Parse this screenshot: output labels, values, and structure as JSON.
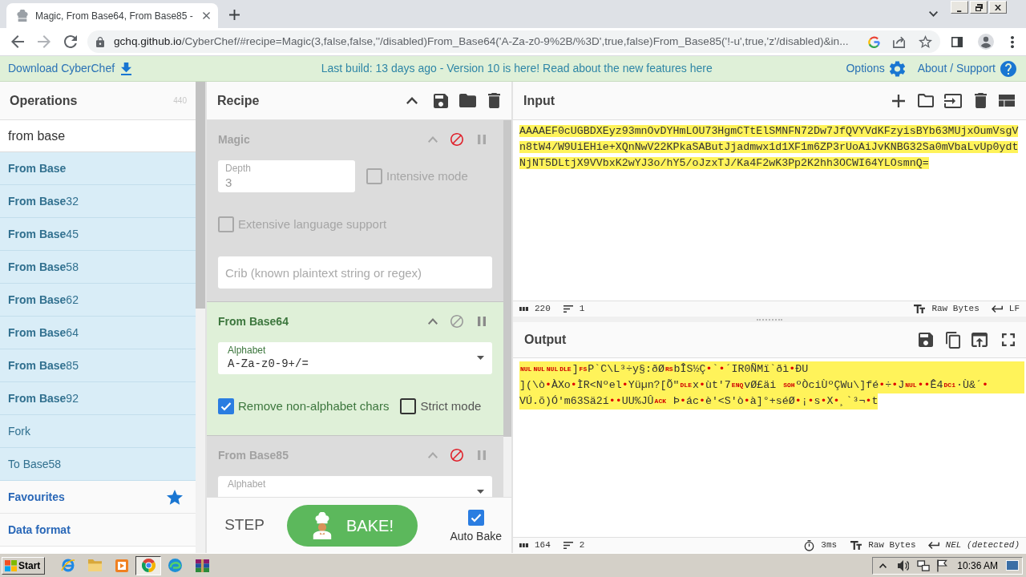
{
  "browser": {
    "tab_title": "Magic, From Base64, From Base85 -",
    "url": {
      "host": "gchq.github.io",
      "path": "/CyberChef/#recipe=Magic(3,false,false,''/disabled)From_Base64('A-Za-z0-9%2B/%3D',true,false)From_Base85('!-u',true,'z'/disabled)&in..."
    }
  },
  "banner": {
    "download": "Download CyberChef",
    "notice": "Last build: 13 days ago - Version 10 is here! Read about the new features here",
    "options": "Options",
    "about": "About / Support"
  },
  "operations": {
    "title": "Operations",
    "count": "440",
    "search": "from base",
    "items": [
      {
        "kind": "operation",
        "match": "From Base"
      },
      {
        "kind": "operation",
        "match": "From Base",
        "rest": "32"
      },
      {
        "kind": "operation",
        "match": "From Base",
        "rest": "45"
      },
      {
        "kind": "operation",
        "match": "From Base",
        "rest": "58"
      },
      {
        "kind": "operation",
        "match": "From Base",
        "rest": "62"
      },
      {
        "kind": "operation",
        "match": "From Base",
        "rest": "64"
      },
      {
        "kind": "operation",
        "match": "From Base",
        "rest": "85"
      },
      {
        "kind": "operation",
        "match": "From Base",
        "rest": "92"
      },
      {
        "kind": "operation",
        "rest": "Fork"
      },
      {
        "kind": "operation",
        "rest": "To Base58"
      },
      {
        "kind": "category",
        "rest": "Favourites",
        "star": true
      },
      {
        "kind": "category",
        "rest": "Data format"
      }
    ]
  },
  "recipe": {
    "title": "Recipe",
    "ops": [
      {
        "name": "Magic",
        "disabled": true,
        "args": [
          {
            "kind": "number",
            "label": "Depth",
            "value": "3"
          },
          {
            "kind": "checkbox",
            "label": "Intensive mode",
            "checked": false
          },
          {
            "kind": "checkbox",
            "label": "Extensive language support",
            "checked": false
          },
          {
            "kind": "text",
            "placeholder": "Crib (known plaintext string or regex)"
          }
        ]
      },
      {
        "name": "From Base64",
        "disabled": false,
        "args": [
          {
            "kind": "select",
            "label": "Alphabet",
            "value": "A-Za-z0-9+/="
          },
          {
            "kind": "checkbox",
            "label": "Remove non-alphabet chars",
            "checked": true
          },
          {
            "kind": "checkbox",
            "label": "Strict mode",
            "checked": false
          }
        ]
      },
      {
        "name": "From Base85",
        "disabled": true,
        "args": [
          {
            "kind": "select",
            "label": "Alphabet"
          }
        ]
      }
    ],
    "step": "STEP",
    "bake": "BAKE!",
    "auto_bake": {
      "label": "Auto Bake",
      "checked": true
    }
  },
  "input": {
    "title": "Input",
    "text": "AAAAEF0cUGBDXEyz93mnOvDYHmLOU73HgmCTtElSMNFN72Dw7JfQVYVdKFzyisBYb63MUjxOumVsgVn8tW4/W9UiEHie+XQnNwV22KPkaSAButJjadmwx1d1XF1m6ZP3rUoAiJvKNBG32Sa0mVbaLvUp0ydtNjNT5DLtjX9VVbxK2wYJ3o/hY5/oJzxTJ/Ka4F2wK3Pp2K2hh3OCWI64YLOsmnQ=",
    "highlighted": true,
    "status": {
      "length": "220",
      "lines": "1",
      "format": "Raw Bytes",
      "eol": "LF"
    }
  },
  "output": {
    "title": "Output",
    "highlighted": true,
    "lines": [
      {
        "segments": [
          {
            "kind": "control",
            "text": "NUL"
          },
          {
            "kind": "control",
            "text": "NUL"
          },
          {
            "kind": "control",
            "text": "NUL"
          },
          {
            "kind": "control",
            "text": "DLE"
          },
          {
            "kind": "text",
            "text": "]"
          },
          {
            "kind": "control",
            "text": "FS"
          },
          {
            "kind": "text",
            "text": "P`C\\L³÷y§:ðØ"
          },
          {
            "kind": "control",
            "text": "RS"
          },
          {
            "kind": "text",
            "text": "bÎS½Ç"
          },
          {
            "kind": "special",
            "text": "•"
          },
          {
            "kind": "text",
            "text": "`"
          },
          {
            "kind": "special",
            "text": "•"
          },
          {
            "kind": "text",
            "text": "´IR0ÑMï`ðì"
          },
          {
            "kind": "special",
            "text": "•"
          },
          {
            "kind": "text",
            "text": "ÐU"
          }
        ]
      },
      {
        "segments": [
          {
            "kind": "text",
            "text": "](\\ò"
          },
          {
            "kind": "special",
            "text": "•"
          },
          {
            "kind": "text",
            "text": "ÀXo"
          },
          {
            "kind": "special",
            "text": "•"
          },
          {
            "kind": "text",
            "text": "ÌR<Nºel"
          },
          {
            "kind": "special",
            "text": "•"
          },
          {
            "kind": "text",
            "text": "Yüµn?[Õ\""
          },
          {
            "kind": "control",
            "text": "DLE"
          },
          {
            "kind": "text",
            "text": "x"
          },
          {
            "kind": "special",
            "text": "•"
          },
          {
            "kind": "text",
            "text": "ùt'7"
          },
          {
            "kind": "control",
            "text": "ENQ"
          },
          {
            "kind": "text",
            "text": "vØ£äi "
          },
          {
            "kind": "control",
            "text": "SOH"
          },
          {
            "kind": "text",
            "text": "ºÒciÙºÇWu\\]fé"
          },
          {
            "kind": "special",
            "text": "•"
          },
          {
            "kind": "text",
            "text": "÷"
          },
          {
            "kind": "special",
            "text": "•"
          },
          {
            "kind": "text",
            "text": "J"
          },
          {
            "kind": "control",
            "text": "NUL"
          },
          {
            "kind": "special",
            "text": "••"
          },
          {
            "kind": "text",
            "text": "Ê4"
          },
          {
            "kind": "control",
            "text": "DC1"
          },
          {
            "kind": "text",
            "text": "·Ù&´"
          },
          {
            "kind": "special",
            "text": "•"
          }
        ]
      },
      {
        "segments": [
          {
            "kind": "text",
            "text": "VÚ.õ)Ó'm63Sä2í"
          },
          {
            "kind": "special",
            "text": "••"
          },
          {
            "kind": "text",
            "text": "UU%JÛ"
          },
          {
            "kind": "control",
            "text": "ACK"
          },
          {
            "kind": "text",
            "text": " Þ"
          },
          {
            "kind": "special",
            "text": "•"
          },
          {
            "kind": "text",
            "text": "ác"
          },
          {
            "kind": "special",
            "text": "•"
          },
          {
            "kind": "text",
            "text": "è'<S'ò"
          },
          {
            "kind": "special",
            "text": "•"
          },
          {
            "kind": "text",
            "text": "à]°+séØ"
          },
          {
            "kind": "special",
            "text": "•"
          },
          {
            "kind": "text",
            "text": "¡"
          },
          {
            "kind": "special",
            "text": "•"
          },
          {
            "kind": "text",
            "text": "s"
          },
          {
            "kind": "special",
            "text": "•"
          },
          {
            "kind": "text",
            "text": "X"
          },
          {
            "kind": "special",
            "text": "•"
          },
          {
            "kind": "text",
            "text": "¸`³¬"
          },
          {
            "kind": "special",
            "text": "•"
          },
          {
            "kind": "text",
            "text": "t"
          }
        ]
      }
    ],
    "status": {
      "length": "164",
      "lines": "2",
      "time": "3ms",
      "format": "Raw Bytes",
      "eol": "NEL (detected)"
    }
  },
  "taskbar": {
    "start": "Start",
    "clock": "10:36 AM"
  }
}
